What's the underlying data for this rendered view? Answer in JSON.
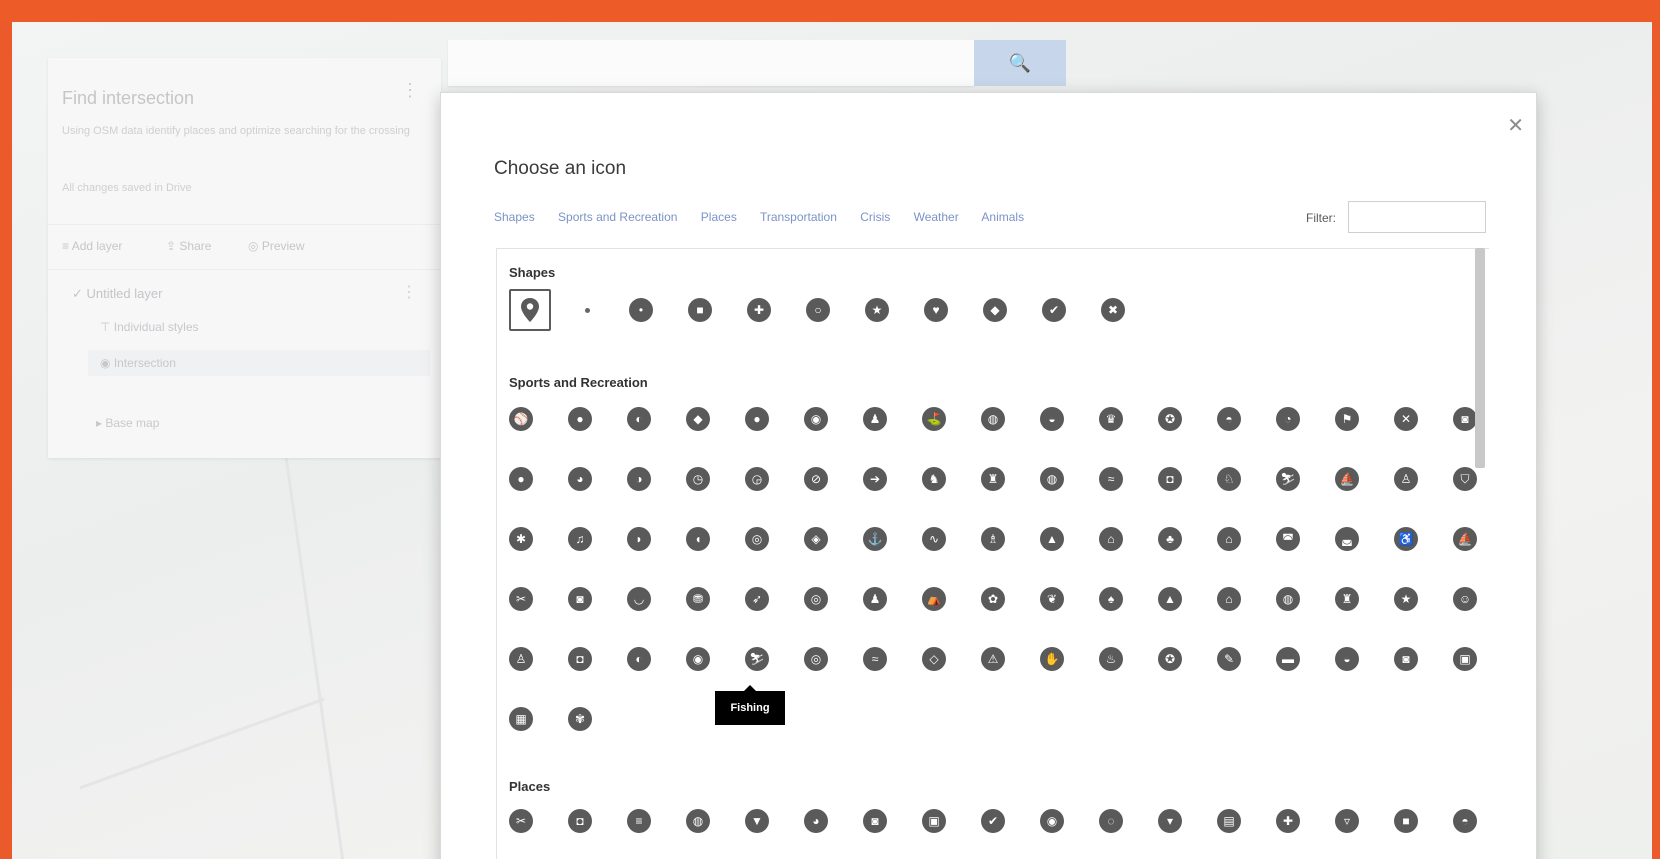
{
  "app": {
    "accent_color": "#ec5b28"
  },
  "left_panel": {
    "title": "Find intersection",
    "description": "Using OSM data identify places and optimize searching for the crossing",
    "saved": "All changes saved in Drive",
    "actions": [
      {
        "label": "Add layer",
        "icon": "add-layer-icon"
      },
      {
        "label": "Share",
        "icon": "share-icon"
      },
      {
        "label": "Preview",
        "icon": "preview-icon"
      }
    ],
    "layer_title": "Untitled layer",
    "items": [
      {
        "label": "Individual styles",
        "icon": "style-icon"
      },
      {
        "label": "Intersection",
        "icon": "marker-icon"
      }
    ],
    "base_map": "Base map"
  },
  "search": {
    "button_icon": "🔍",
    "placeholder": ""
  },
  "dialog": {
    "title": "Choose an icon",
    "close_icon": "✕",
    "categories": [
      "Shapes",
      "Sports and Recreation",
      "Places",
      "Transportation",
      "Crisis",
      "Weather",
      "Animals"
    ],
    "filter_label": "Filter:",
    "sections": {
      "shapes": "Shapes",
      "sports": "Sports and Recreation",
      "places": "Places"
    },
    "tooltip": "Fishing"
  }
}
